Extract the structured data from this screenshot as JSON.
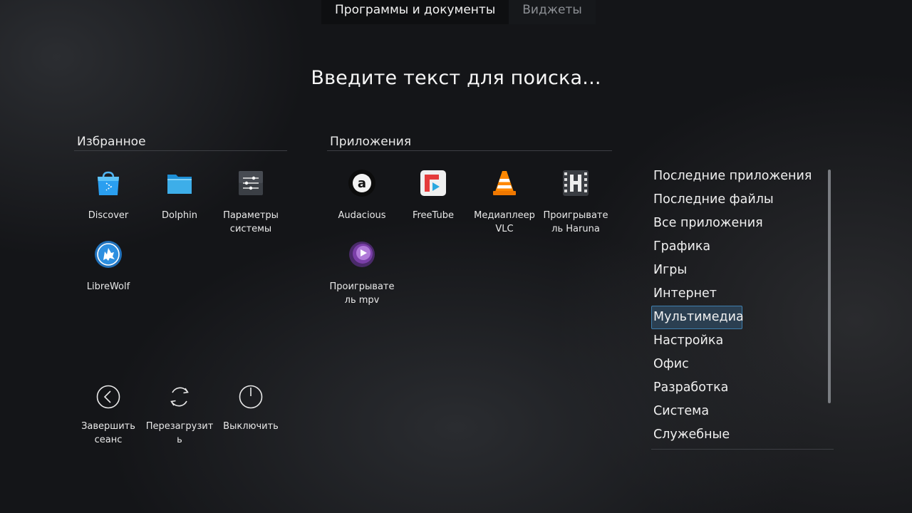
{
  "tabs": [
    {
      "label": "Программы и документы",
      "active": true
    },
    {
      "label": "Виджеты",
      "active": false
    }
  ],
  "search": {
    "placeholder": "Введите текст для поиска..."
  },
  "favorites": {
    "title": "Избранное",
    "items": [
      {
        "label": "Discover",
        "icon": "discover-icon"
      },
      {
        "label": "Dolphin",
        "icon": "folder-icon"
      },
      {
        "label": "Параметры системы",
        "icon": "settings-icon"
      },
      {
        "label": "LibreWolf",
        "icon": "librewolf-icon"
      }
    ]
  },
  "applications": {
    "title": "Приложения",
    "items": [
      {
        "label": "Audacious",
        "icon": "audacious-icon"
      },
      {
        "label": "FreeTube",
        "icon": "freetube-icon"
      },
      {
        "label": "Медиаплеер VLC",
        "icon": "vlc-icon"
      },
      {
        "label": "Проигрывате ль Haruna",
        "icon": "haruna-icon"
      },
      {
        "label": "Проигрывате ль mpv",
        "icon": "mpv-icon"
      }
    ]
  },
  "power": [
    {
      "label": "Завершить сеанс",
      "icon": "logout-icon"
    },
    {
      "label": "Перезагрузит ь",
      "icon": "restart-icon"
    },
    {
      "label": "Выключить",
      "icon": "shutdown-icon"
    }
  ],
  "categories": {
    "selected": "Мультимедиа",
    "items": [
      "Последние приложения",
      "Последние файлы",
      "Все приложения",
      "Графика",
      "Игры",
      "Интернет",
      "Мультимедиа",
      "Настройка",
      "Офис",
      "Разработка",
      "Система",
      "Служебные"
    ]
  },
  "colors": {
    "accent": "#3f7fae",
    "selected_bg": "#2b3f51",
    "background": "#141518"
  }
}
